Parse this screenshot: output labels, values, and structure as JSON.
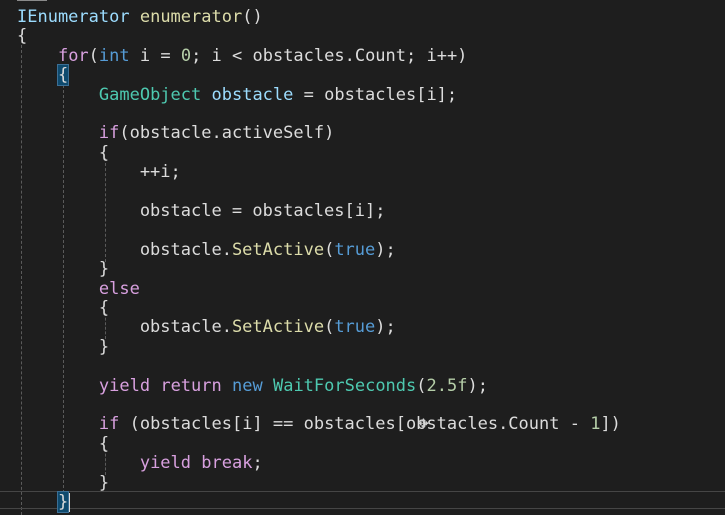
{
  "colors": {
    "background": "#1e1e1e",
    "default": "#dcdcdc",
    "keyword": "#569cd6",
    "control": "#d8a0df",
    "type": "#4ec9b0",
    "variable": "#9cdcfe",
    "method": "#dcdcaa",
    "number": "#b5cea8",
    "guide": "#5a5a5a"
  },
  "code": [
    [
      {
        "t": "IEnumerator",
        "c": "variable"
      },
      {
        "t": " ",
        "c": "default"
      },
      {
        "t": "enumerator",
        "c": "method"
      },
      {
        "t": "()",
        "c": "default"
      }
    ],
    [
      {
        "t": "{",
        "c": "default"
      }
    ],
    [
      {
        "t": "    ",
        "c": "default"
      },
      {
        "t": "for",
        "c": "control"
      },
      {
        "t": "(",
        "c": "default"
      },
      {
        "t": "int",
        "c": "keyword"
      },
      {
        "t": " i = ",
        "c": "default"
      },
      {
        "t": "0",
        "c": "number"
      },
      {
        "t": "; i < obstacles.Count; i++)",
        "c": "default"
      }
    ],
    [
      {
        "t": "    ",
        "c": "default"
      },
      {
        "t": "{",
        "c": "default",
        "match": true
      }
    ],
    [
      {
        "t": "        ",
        "c": "default"
      },
      {
        "t": "GameObject",
        "c": "type"
      },
      {
        "t": " ",
        "c": "default"
      },
      {
        "t": "obstacle",
        "c": "variable"
      },
      {
        "t": " = obstacles[i];",
        "c": "default"
      }
    ],
    [],
    [
      {
        "t": "        ",
        "c": "default"
      },
      {
        "t": "if",
        "c": "control"
      },
      {
        "t": "(obstacle.activeSelf)",
        "c": "default"
      }
    ],
    [
      {
        "t": "        {",
        "c": "default"
      }
    ],
    [
      {
        "t": "            ++i;",
        "c": "default"
      }
    ],
    [],
    [
      {
        "t": "            obstacle = obstacles[i];",
        "c": "default"
      }
    ],
    [],
    [
      {
        "t": "            obstacle.",
        "c": "default"
      },
      {
        "t": "SetActive",
        "c": "method"
      },
      {
        "t": "(",
        "c": "default"
      },
      {
        "t": "true",
        "c": "keyword"
      },
      {
        "t": ");",
        "c": "default"
      }
    ],
    [
      {
        "t": "        }",
        "c": "default"
      }
    ],
    [
      {
        "t": "        ",
        "c": "default"
      },
      {
        "t": "else",
        "c": "control"
      }
    ],
    [
      {
        "t": "        {",
        "c": "default"
      }
    ],
    [
      {
        "t": "            obstacle.",
        "c": "default"
      },
      {
        "t": "SetActive",
        "c": "method"
      },
      {
        "t": "(",
        "c": "default"
      },
      {
        "t": "true",
        "c": "keyword"
      },
      {
        "t": ");",
        "c": "default"
      }
    ],
    [
      {
        "t": "        }",
        "c": "default"
      }
    ],
    [],
    [
      {
        "t": "        ",
        "c": "default"
      },
      {
        "t": "yield",
        "c": "control"
      },
      {
        "t": " ",
        "c": "default"
      },
      {
        "t": "return",
        "c": "control"
      },
      {
        "t": " ",
        "c": "default"
      },
      {
        "t": "new",
        "c": "keyword"
      },
      {
        "t": " ",
        "c": "default"
      },
      {
        "t": "WaitForSeconds",
        "c": "type"
      },
      {
        "t": "(",
        "c": "default"
      },
      {
        "t": "2.5f",
        "c": "number"
      },
      {
        "t": ");",
        "c": "default"
      }
    ],
    [],
    [
      {
        "t": "        ",
        "c": "default"
      },
      {
        "t": "if",
        "c": "control"
      },
      {
        "t": " (obstacles[i] == obstacles[obstacles.Count - ",
        "c": "default"
      },
      {
        "t": "1",
        "c": "number"
      },
      {
        "t": "])",
        "c": "default"
      }
    ],
    [
      {
        "t": "        {",
        "c": "default"
      }
    ],
    [
      {
        "t": "            ",
        "c": "default"
      },
      {
        "t": "yield",
        "c": "control"
      },
      {
        "t": " ",
        "c": "default"
      },
      {
        "t": "break",
        "c": "control"
      },
      {
        "t": ";",
        "c": "default"
      }
    ],
    [
      {
        "t": "        }",
        "c": "default"
      }
    ],
    [
      {
        "t": "    ",
        "c": "default"
      },
      {
        "t": "}",
        "c": "default",
        "match": true,
        "caret": true
      }
    ]
  ]
}
